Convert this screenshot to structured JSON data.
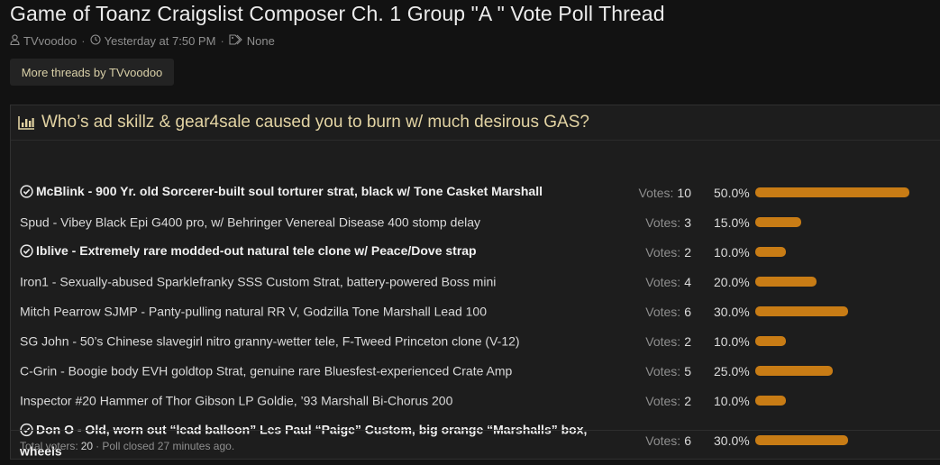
{
  "thread": {
    "title": "Game of Toanz Craigslist Composer Ch. 1 Group \"A \" Vote Poll Thread",
    "author": "TVvoodoo",
    "date": "Yesterday at 7:50 PM",
    "tags": "None",
    "more_threads_label": "More threads by TVvoodoo"
  },
  "poll": {
    "question": "Who’s ad skillz & gear4sale caused you to burn w/ much desirous GAS?",
    "votes_label": "Votes:",
    "options": [
      {
        "text": "McBlink - 900 Yr. old Sorcerer-built soul torturer strat, black w/ Tone Casket Marshall",
        "votes": "10",
        "percent": "50.0%",
        "fraction": 0.5,
        "voted": true
      },
      {
        "text": "Spud - Vibey Black Epi G400 pro, w/ Behringer Venereal Disease 400 stomp delay",
        "votes": "3",
        "percent": "15.0%",
        "fraction": 0.15,
        "voted": false
      },
      {
        "text": "Iblive - Extremely rare modded-out natural tele clone w/ Peace/Dove strap",
        "votes": "2",
        "percent": "10.0%",
        "fraction": 0.1,
        "voted": true
      },
      {
        "text": "Iron1 - Sexually-abused Sparklefranky SSS Custom Strat, battery-powered Boss mini",
        "votes": "4",
        "percent": "20.0%",
        "fraction": 0.2,
        "voted": false
      },
      {
        "text": "Mitch Pearrow SJMP - Panty-pulling natural RR V, Godzilla Tone Marshall Lead 100",
        "votes": "6",
        "percent": "30.0%",
        "fraction": 0.3,
        "voted": false
      },
      {
        "text": "SG John - 50’s Chinese slavegirl nitro granny-wetter tele, F-Tweed Princeton clone (V-12)",
        "votes": "2",
        "percent": "10.0%",
        "fraction": 0.1,
        "voted": false
      },
      {
        "text": "C-Grin - Boogie body EVH goldtop Strat, genuine rare Bluesfest-experienced Crate Amp",
        "votes": "5",
        "percent": "25.0%",
        "fraction": 0.25,
        "voted": false
      },
      {
        "text": "Inspector #20 Hammer of Thor Gibson LP Goldie, ’93 Marshall Bi-Chorus 200",
        "votes": "2",
        "percent": "10.0%",
        "fraction": 0.1,
        "voted": false
      },
      {
        "text": "Don O - Old, worn out “lead balloon” Les Paul “Paige” Custom, big orange “Marshalls” box, wheels",
        "votes": "6",
        "percent": "30.0%",
        "fraction": 0.3,
        "voted": true
      }
    ],
    "footer": {
      "total_label": "Total voters:",
      "total": "20",
      "status": "Poll closed 27 minutes ago."
    },
    "bar_color": "#c87c15"
  }
}
